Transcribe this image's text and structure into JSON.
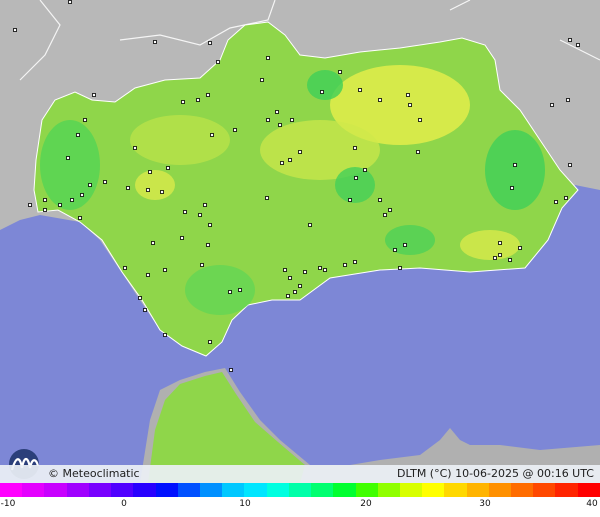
{
  "brand": {
    "label": "© Meteoclimatic"
  },
  "credit": {
    "label": "DLTM (°C)   10-06-2025 @ 00:16 UTC"
  },
  "legend": {
    "ticks": [
      "-10",
      "0",
      "10",
      "20",
      "30",
      "40"
    ],
    "colors": [
      "#ff00ff",
      "#e400ff",
      "#c800ff",
      "#a000ff",
      "#7800ff",
      "#5000ff",
      "#2800ff",
      "#0010ff",
      "#0050ff",
      "#0090ff",
      "#00c8ff",
      "#00e6ff",
      "#00ffe0",
      "#00ffa8",
      "#00ff70",
      "#00ff30",
      "#40ff00",
      "#90ff00",
      "#d8ff00",
      "#ffff00",
      "#ffd800",
      "#ffb400",
      "#ff9000",
      "#ff6c00",
      "#ff4800",
      "#ff2400",
      "#ff0000"
    ]
  },
  "map": {
    "sea_color": "#7d87d6",
    "land_color": "#b4b4b4",
    "region_color": "#8fd64a",
    "warm_color": "#e3ed4a",
    "cool_color": "#3fcf58"
  }
}
